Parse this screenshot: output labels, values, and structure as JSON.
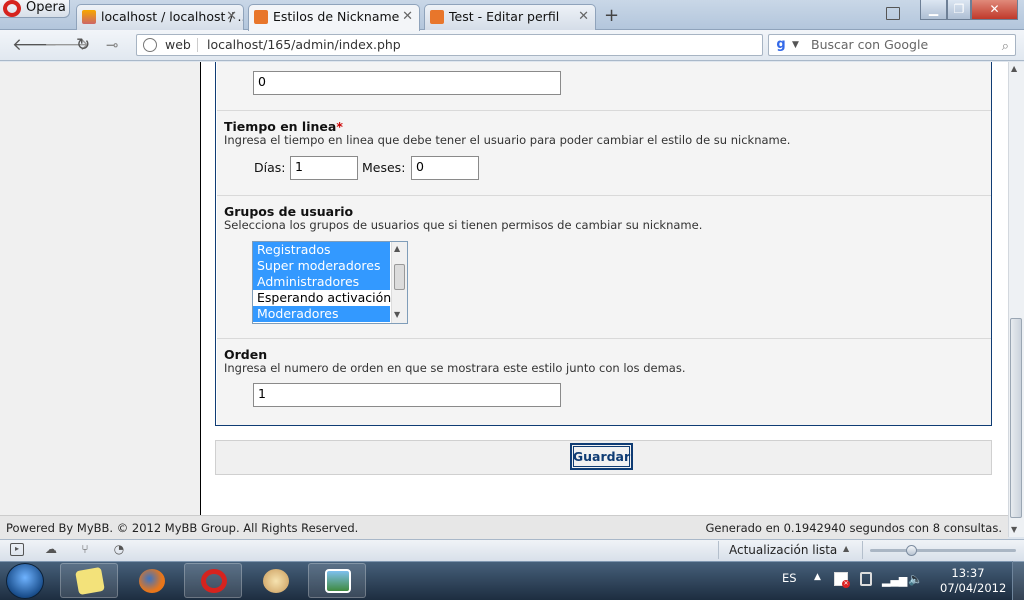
{
  "browser": {
    "menu_label": "Opera",
    "tabs": [
      {
        "label": "localhost / localhost / ...",
        "icon": "phpmyadmin-icon"
      },
      {
        "label": "Estilos de Nickname",
        "icon": "mybb-icon",
        "active": true
      },
      {
        "label": "Test - Editar perfil",
        "icon": "mybb-icon"
      }
    ],
    "address": {
      "prefix": "web",
      "url": "localhost/165/admin/index.php"
    },
    "search_placeholder": "Buscar con Google"
  },
  "form": {
    "top_input_value": "0",
    "online_time": {
      "label": "Tiempo en linea",
      "required_mark": "*",
      "description": "Ingresa el tiempo en linea que debe tener el usuario para poder cambiar el estilo de su nickname.",
      "days_label": "Días:",
      "days_value": "1",
      "months_label": "Meses:",
      "months_value": "0"
    },
    "user_groups": {
      "label": "Grupos de usuario",
      "description": "Selecciona los grupos de usuarios que si tienen permisos de cambiar su nickname.",
      "options": [
        {
          "label": "Registrados",
          "selected": true
        },
        {
          "label": "Super moderadores",
          "selected": true
        },
        {
          "label": "Administradores",
          "selected": true
        },
        {
          "label": "Esperando activación",
          "selected": false
        },
        {
          "label": "Moderadores",
          "selected": true
        }
      ]
    },
    "order": {
      "label": "Orden",
      "description": "Ingresa el numero de orden en que se mostrara este estilo junto con los demas.",
      "value": "1"
    },
    "save_label": "Guardar"
  },
  "footer": {
    "left": "Powered By MyBB. © 2012 MyBB Group. All Rights Reserved.",
    "right": "Generado en 0.1942940 segundos con 8 consultas."
  },
  "statusbar": {
    "update_label": "Actualización lista"
  },
  "taskbar": {
    "language": "ES",
    "time": "13:37",
    "date": "07/04/2012"
  },
  "colors": {
    "selection": "#3399ff",
    "mybb_blue": "#0f3c74",
    "required": "#cc0000"
  }
}
